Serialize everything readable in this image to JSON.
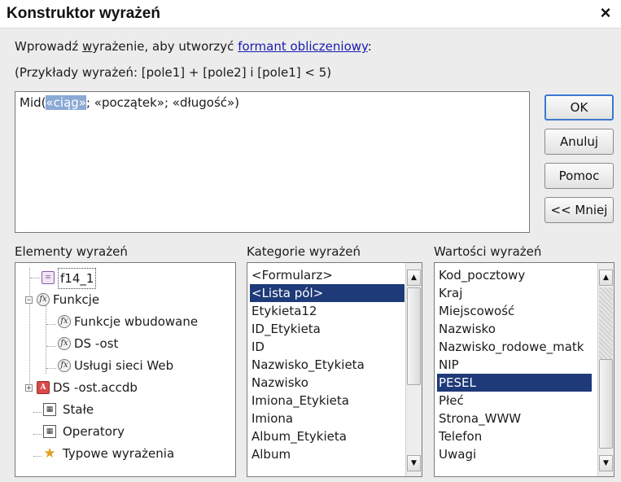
{
  "window": {
    "title": "Konstruktor wyrażeń",
    "close_icon": "close-icon",
    "close_glyph": "×"
  },
  "instructions": {
    "prefix": "Wprowadź ",
    "underlined": "w",
    "middle": "yrażenie, aby utworzyć ",
    "link": "formant obliczeniowy",
    "suffix": ":"
  },
  "examples": "(Przykłady wyrażeń: [pole1] + [pole2] i [pole1] < 5)",
  "expression": {
    "before": "Mid(",
    "highlighted": "«ciąg»",
    "after": "; «początek»; «długość»)"
  },
  "buttons": {
    "ok": "OK",
    "cancel": "Anuluj",
    "help": "Pomoc",
    "less": "<< Mniej"
  },
  "elements": {
    "label": "Elementy wyrażeń",
    "items": [
      {
        "label": "f14_1",
        "icon": "form-icon",
        "glyph": "≡"
      },
      {
        "label": "Funkcje",
        "icon": "function-icon",
        "glyph": "fx",
        "expander": "−"
      },
      {
        "label": "Funkcje wbudowane",
        "icon": "function-icon",
        "glyph": "fx"
      },
      {
        "label": "DS -ost",
        "icon": "function-icon",
        "glyph": "fx"
      },
      {
        "label": "Usługi sieci Web",
        "icon": "function-icon",
        "glyph": "fx"
      },
      {
        "label": "DS -ost.accdb",
        "icon": "database-icon",
        "glyph": "A",
        "expander": "+"
      },
      {
        "label": "Stałe",
        "icon": "constants-icon",
        "glyph": "▦"
      },
      {
        "label": "Operatory",
        "icon": "operators-icon",
        "glyph": "▦"
      },
      {
        "label": "Typowe wyrażenia",
        "icon": "common-expressions-icon",
        "glyph": "★"
      }
    ]
  },
  "categories": {
    "label": "Kategorie wyrażeń",
    "selected": "<Lista pól>",
    "items": [
      "<Formularz>",
      "<Lista pól>",
      "Etykieta12",
      "ID_Etykieta",
      "ID",
      "Nazwisko_Etykieta",
      "Nazwisko",
      "Imiona_Etykieta",
      "Imiona",
      "Album_Etykieta",
      "Album"
    ]
  },
  "values": {
    "label": "Wartości wyrażeń",
    "selected": "PESEL",
    "items": [
      "Kod_pocztowy",
      "Kraj",
      "Miejscowość",
      "Nazwisko",
      "Nazwisko_rodowe_matk",
      "NIP",
      "PESEL",
      "Płeć",
      "Strona_WWW",
      "Telefon",
      "Uwagi"
    ]
  },
  "scrollbar": {
    "up_glyph": "▲",
    "down_glyph": "▼"
  },
  "colors": {
    "selection": "#1e3a78",
    "highlight": "#8aa9d4",
    "link": "#1a1ab0",
    "ok_border": "#3b77d0"
  }
}
